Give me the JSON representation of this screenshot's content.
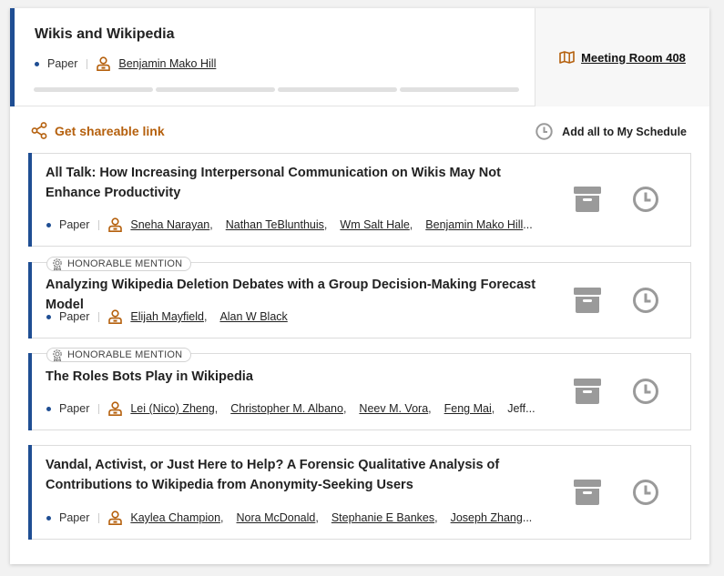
{
  "session": {
    "title": "Wikis and Wikipedia",
    "type": "Paper",
    "author": "Benjamin Mako Hill",
    "room": "Meeting Room 408"
  },
  "actions": {
    "share_label": "Get shareable link",
    "add_all_label": "Add all to My Schedule"
  },
  "papers": [
    {
      "title": "All Talk: How Increasing Interpersonal Communication on Wikis May Not Enhance Productivity",
      "type": "Paper",
      "badge": "",
      "authors": [
        "Sneha Narayan",
        "Nathan TeBlunthuis",
        "Wm Salt Hale",
        "Benjamin Mako Hill"
      ],
      "ellipsis": "..."
    },
    {
      "title": "Analyzing Wikipedia Deletion Debates with a Group Decision-Making Forecast Model",
      "type": "Paper",
      "badge": "HONORABLE MENTION",
      "authors": [
        "Elijah Mayfield",
        "Alan W Black"
      ],
      "ellipsis": ""
    },
    {
      "title": "The Roles Bots Play in Wikipedia",
      "type": "Paper",
      "badge": "HONORABLE MENTION",
      "authors": [
        "Lei (Nico) Zheng",
        "Christopher M. Albano",
        "Neev M. Vora",
        "Feng Mai"
      ],
      "ellipsis": "Jeff..."
    },
    {
      "title": "Vandal, Activist, or Just Here to Help? A Forensic Qualitative Analysis of Contributions to Wikipedia from Anonymity-Seeking Users",
      "type": "Paper",
      "badge": "",
      "authors": [
        "Kaylea Champion",
        "Nora McDonald",
        "Stephanie E Bankes",
        "Joseph Zhang"
      ],
      "ellipsis": "..."
    }
  ],
  "colors": {
    "accent": "#1f4e93",
    "brand_orange": "#b5600d",
    "icon_gray": "#9a9a9a"
  },
  "icons": {
    "room": "map-icon",
    "share": "share-icon",
    "schedule": "clock-icon",
    "archive": "archive-icon",
    "person": "person-icon",
    "badge": "award-icon"
  }
}
